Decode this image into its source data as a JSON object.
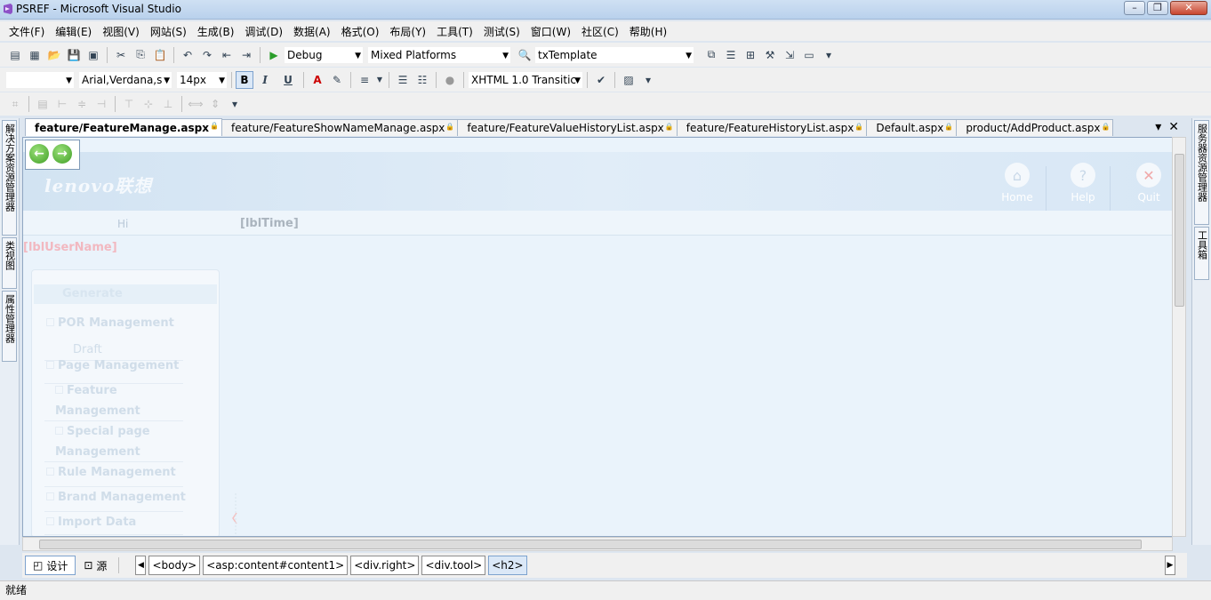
{
  "window": {
    "title": "PSREF - Microsoft Visual Studio",
    "minimize_symbol": "–",
    "maximize_symbol": "❐",
    "close_symbol": "✕"
  },
  "menu": [
    "文件(F)",
    "编辑(E)",
    "视图(V)",
    "网站(S)",
    "生成(B)",
    "调试(D)",
    "数据(A)",
    "格式(O)",
    "布局(Y)",
    "工具(T)",
    "测试(S)",
    "窗口(W)",
    "社区(C)",
    "帮助(H)"
  ],
  "toolbar1": {
    "config": "Debug",
    "platform": "Mixed Platforms",
    "find_value": "txTemplate"
  },
  "toolbar2": {
    "font_family": "Arial,Verdana,s",
    "font_size": "14px",
    "bold": "B",
    "italic": "I",
    "underline": "U",
    "doctype": "XHTML 1.0 Transitic"
  },
  "tabs": [
    "feature/FeatureManage.aspx",
    "feature/FeatureShowNameManage.aspx",
    "feature/FeatureValueHistoryList.aspx",
    "feature/FeatureHistoryList.aspx",
    "Default.aspx",
    "product/AddProduct.aspx"
  ],
  "left_panels": [
    "解决方案资源管理器",
    "类视图",
    "属性管理器"
  ],
  "right_panels": [
    "服务器资源管理器",
    "工具箱"
  ],
  "designer": {
    "logo": "lenovo联想",
    "header_buttons": [
      "Home",
      "Help",
      "Quit"
    ],
    "hi": "Hi",
    "lbl_time": "[lblTime]",
    "lbl_username": "[lblUserName]",
    "nav_header": "Generate",
    "nav_items": [
      {
        "label": "POR Management"
      },
      {
        "label": "Draft"
      },
      {
        "label": "Page Management"
      },
      {
        "label": "Feature Management"
      },
      {
        "label": "Special page Management"
      },
      {
        "label": "Rule Management"
      },
      {
        "label": "Brand Management"
      },
      {
        "label": "Import Data"
      }
    ]
  },
  "bottom": {
    "design_label": "设计",
    "source_label": "源",
    "breadcrumbs": [
      "<body>",
      "<asp:content#content1>",
      "<div.right>",
      "<div.tool>",
      "<h2>"
    ]
  },
  "status": "就绪",
  "colors": {
    "accent": "#7da2ce",
    "designer_bg": "#eaf3fb",
    "banner": "#d2e3f2"
  }
}
